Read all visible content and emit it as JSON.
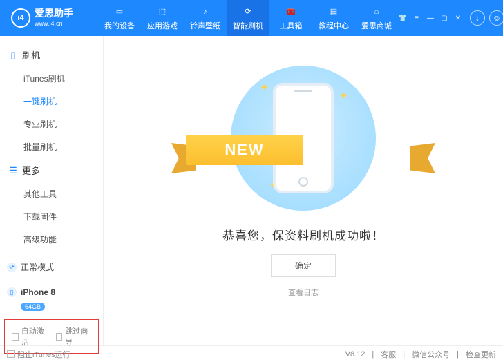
{
  "app": {
    "name": "爱思助手",
    "url": "www.i4.cn",
    "logo": "i4"
  },
  "window_buttons": [
    "tshirt",
    "menu",
    "min",
    "max",
    "close"
  ],
  "header_icons": [
    "download",
    "user"
  ],
  "tabs": [
    {
      "label": "我的设备",
      "icon": "phone"
    },
    {
      "label": "应用游戏",
      "icon": "apps"
    },
    {
      "label": "铃声壁纸",
      "icon": "music"
    },
    {
      "label": "智能刷机",
      "icon": "refresh",
      "active": true
    },
    {
      "label": "工具箱",
      "icon": "toolbox"
    },
    {
      "label": "教程中心",
      "icon": "book"
    },
    {
      "label": "爱思商城",
      "icon": "shop"
    }
  ],
  "sidebar": {
    "groups": [
      {
        "title": "刷机",
        "icon": "phone-icon",
        "items": [
          "iTunes刷机",
          "一键刷机",
          "专业刷机",
          "批量刷机"
        ],
        "active_index": 1
      },
      {
        "title": "更多",
        "icon": "menu-icon",
        "items": [
          "其他工具",
          "下载固件",
          "高级功能"
        ]
      }
    ],
    "status": {
      "mode": "正常模式",
      "device": "iPhone 8",
      "storage": "64GB"
    },
    "checks": [
      "自动激活",
      "跳过向导"
    ]
  },
  "main": {
    "ribbon": "NEW",
    "message": "恭喜您，保资料刷机成功啦！",
    "ok": "确定",
    "log": "查看日志"
  },
  "footer": {
    "block_itunes": "阻止iTunes运行",
    "version": "V8.12",
    "links": [
      "客服",
      "微信公众号",
      "检查更新"
    ]
  }
}
